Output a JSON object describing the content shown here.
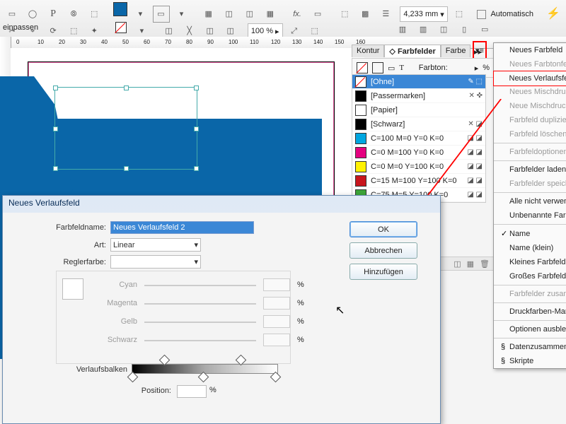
{
  "toolbar": {
    "zoom": "100 %",
    "measure": "4,233 mm",
    "auto_fit": "Automatisch einpassen"
  },
  "ruler_ticks": [
    "0",
    "10",
    "20",
    "30",
    "40",
    "50",
    "60",
    "70",
    "80",
    "90",
    "100",
    "110",
    "120",
    "130",
    "140",
    "150",
    "160"
  ],
  "panel": {
    "tabs": {
      "kontur": "Kontur",
      "farbfelder": "Farbfelder",
      "farbe": "Farbe"
    },
    "tint_label": "Farbton:",
    "tint_unit": "%",
    "swatches": [
      {
        "name": "[Ohne]",
        "hex": "none",
        "selected": true,
        "icons": "✎ ⬚"
      },
      {
        "name": "[Passermarken]",
        "hex": "#000000",
        "icons": "✕ ✜"
      },
      {
        "name": "[Papier]",
        "hex": "#ffffff",
        "icons": ""
      },
      {
        "name": "[Schwarz]",
        "hex": "#000000",
        "icons": "✕ ◪"
      },
      {
        "name": "C=100 M=0 Y=0 K=0",
        "hex": "#00a6e0",
        "icons": "◪ ◪"
      },
      {
        "name": "C=0 M=100 Y=0 K=0",
        "hex": "#e4007f",
        "icons": "◪ ◪"
      },
      {
        "name": "C=0 M=0 Y=100 K=0",
        "hex": "#fff100",
        "icons": "◪ ◪"
      },
      {
        "name": "C=15 M=100 Y=100 K=0",
        "hex": "#c8161d",
        "icons": "◪ ◪"
      },
      {
        "name": "C=75 M=5 Y=100 K=0",
        "hex": "#3da639",
        "icons": "◪ ◪"
      }
    ]
  },
  "flyout": [
    {
      "label": "Neues Farbfeld",
      "disabled": false
    },
    {
      "label": "Neues Farbtonfeld",
      "disabled": true
    },
    {
      "label": "Neues Verlaufsfeld",
      "hl": true
    },
    {
      "label": "Neues Mischdruckfarbenfeld",
      "disabled": true
    },
    {
      "label": "Neue Mischdruckfarbengruppe",
      "disabled": true
    },
    {
      "label": "Farbfeld duplizieren",
      "disabled": true
    },
    {
      "label": "Farbfeld löschen",
      "disabled": true
    },
    {
      "sep": true
    },
    {
      "label": "Farbfeldoptionen",
      "disabled": true
    },
    {
      "sep": true
    },
    {
      "label": "Farbfelder laden"
    },
    {
      "label": "Farbfelder speichern",
      "disabled": true
    },
    {
      "sep": true
    },
    {
      "label": "Alle nicht verwendeten auswählen"
    },
    {
      "label": "Unbenannte Farben hinzufügen"
    },
    {
      "sep": true
    },
    {
      "label": "Name",
      "checked": true
    },
    {
      "label": "Name (klein)"
    },
    {
      "label": "Kleines Farbfeld"
    },
    {
      "label": "Großes Farbfeld"
    },
    {
      "sep": true
    },
    {
      "label": "Farbfelder zusammenführen",
      "disabled": true
    },
    {
      "sep": true
    },
    {
      "label": "Druckfarben-Manager"
    },
    {
      "sep": true
    },
    {
      "label": "Optionen ausblenden"
    },
    {
      "sep": true
    },
    {
      "label": "Datenzusammenführung",
      "icon": true
    },
    {
      "label": "Skripte",
      "icon": true
    }
  ],
  "dialog": {
    "title": "Neues Verlaufsfeld",
    "name_label": "Farbfeldname:",
    "name_value": "Neues Verlaufsfeld 2",
    "type_label": "Art:",
    "type_value": "Linear",
    "stopcolor_label": "Reglerfarbe:",
    "cmyk": {
      "c": "Cyan",
      "m": "Magenta",
      "y": "Gelb",
      "k": "Schwarz",
      "unit": "%"
    },
    "gradient_label": "Verlaufsbalken",
    "position_label": "Position:",
    "position_unit": "%",
    "ok": "OK",
    "cancel": "Abbrechen",
    "add": "Hinzufügen"
  }
}
